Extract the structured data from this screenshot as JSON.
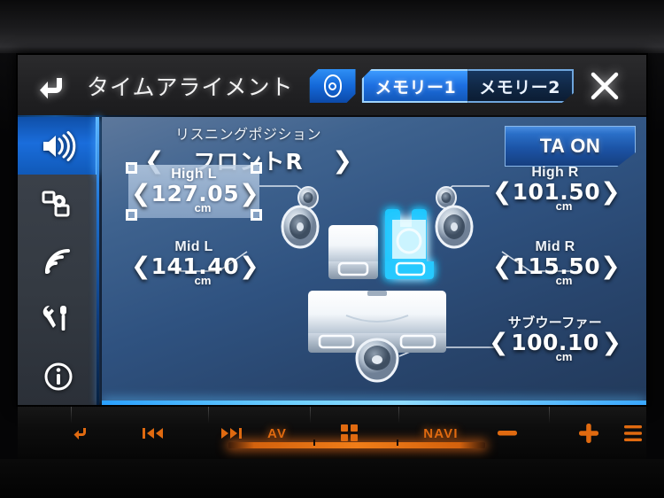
{
  "header": {
    "back_icon": "back-arrow-icon",
    "title": "タイムアライメント",
    "speaker_chip_icon": "speaker-config-icon",
    "memory_tabs": [
      {
        "label": "メモリー1",
        "active": true
      },
      {
        "label": "メモリー2",
        "active": false
      }
    ],
    "close_icon": "close-icon"
  },
  "sidebar": {
    "items": [
      {
        "icon": "speaker-volume-icon",
        "active": true
      },
      {
        "icon": "sources-icon",
        "active": false
      },
      {
        "icon": "wireless-signal-icon",
        "active": false
      },
      {
        "icon": "tools-icon",
        "active": false
      },
      {
        "icon": "info-icon",
        "active": false
      }
    ]
  },
  "listening_position": {
    "label": "リスニングポジション",
    "value": "フロントR",
    "prev_icon": "chevron-left-icon",
    "next_icon": "chevron-right-icon"
  },
  "ta_button": {
    "label": "TA ON",
    "state": "on"
  },
  "unit": "cm",
  "speakers": [
    {
      "name": "high-left",
      "label": "High L",
      "value": "127.05",
      "unit": "cm",
      "selected": true
    },
    {
      "name": "high-right",
      "label": "High R",
      "value": "101.50",
      "unit": "cm",
      "selected": false
    },
    {
      "name": "mid-left",
      "label": "Mid L",
      "value": "141.40",
      "unit": "cm",
      "selected": false
    },
    {
      "name": "mid-right",
      "label": "Mid R",
      "value": "115.50",
      "unit": "cm",
      "selected": false
    },
    {
      "name": "subwoofer",
      "label": "サブウーファー",
      "value": "100.10",
      "unit": "cm",
      "selected": false
    }
  ],
  "diagram": {
    "selected_seat": "front-right",
    "seats": [
      "front-left",
      "front-right",
      "rear-bench"
    ],
    "speaker_positions": [
      "tweeter-left",
      "tweeter-right",
      "mid-left",
      "mid-right",
      "subwoofer"
    ],
    "highlight_color": "#1fc8ff"
  },
  "hardware_bar": {
    "buttons": [
      {
        "name": "back-button",
        "icon": "back-arrow-icon",
        "label": ""
      },
      {
        "name": "prev-track-button",
        "icon": "prev-track-icon",
        "label": ""
      },
      {
        "name": "next-track-button",
        "icon": "next-track-icon",
        "label": ""
      },
      {
        "name": "av-button",
        "icon": "",
        "label": "AV"
      },
      {
        "name": "home-button",
        "icon": "grid-icon",
        "label": ""
      },
      {
        "name": "navi-button",
        "icon": "",
        "label": "NAVI"
      },
      {
        "name": "volume-down-button",
        "icon": "minus-icon",
        "label": ""
      },
      {
        "name": "volume-up-button",
        "icon": "plus-icon",
        "label": ""
      },
      {
        "name": "menu-button",
        "icon": "menu-lines-icon",
        "label": ""
      }
    ]
  },
  "colors": {
    "accent_blue": "#2a7fe0",
    "highlight_cyan": "#1fc8ff",
    "panel_blue": "#2f5280",
    "hw_orange": "#e06a10"
  }
}
